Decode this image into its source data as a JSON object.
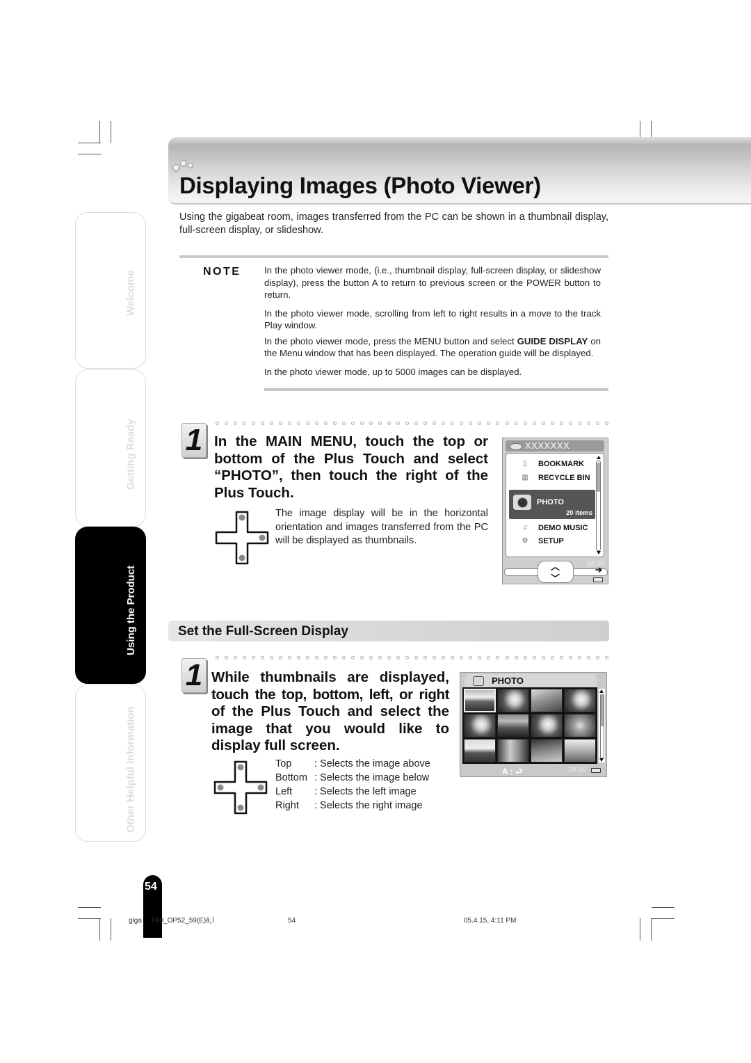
{
  "header": {
    "title": "Displaying Images (Photo Viewer)",
    "intro": "Using the gigabeat room, images transferred from the PC can be shown in a thumbnail display, full-screen display, or slideshow."
  },
  "note": {
    "label": "NOTE",
    "items": [
      {
        "text": "In the photo viewer mode, (i.e., thumbnail display, full-screen display, or slideshow display), press the button A to return to previous screen or the POWER button to return."
      },
      {
        "text": "In the photo viewer mode, scrolling from left to right results in a move to the track Play window."
      },
      {
        "pre": "In the photo viewer mode, press the MENU button and select ",
        "bold": "GUIDE DISPLAY",
        "post": " on the Menu window that has been displayed. The operation guide will be displayed."
      },
      {
        "text": "In the photo viewer mode, up to 5000 images can be displayed."
      }
    ]
  },
  "step1": {
    "number": "1",
    "heading_lines": [
      "In the MAIN MENU, touch the top or",
      "bottom of the Plus Touch and select",
      "“PHOTO”, then touch the right of the",
      "Plus Touch."
    ],
    "body": "The image display will be in the horizontal orientation and images transferred from the PC will be displayed as thumbnails."
  },
  "device_menu": {
    "title": "XXXXXXX",
    "items": [
      {
        "label": "BOOKMARK",
        "icon": "bookmark-icon"
      },
      {
        "label": "RECYCLE BIN",
        "icon": "recycle-bin-icon"
      },
      {
        "label": "PHOTO",
        "icon": "camera-icon",
        "count": "20 items",
        "selected": true
      },
      {
        "label": "DEMO MUSIC",
        "icon": "music-icon"
      },
      {
        "label": "SETUP",
        "icon": "setup-icon"
      }
    ],
    "time": "18:30",
    "arrow": "➔"
  },
  "section": {
    "title": "Set the Full-Screen Display"
  },
  "step2": {
    "number": "1",
    "heading_lines": [
      "While thumbnails are displayed,",
      "touch the top, bottom, left, or right",
      "of the Plus Touch and select the",
      "image that you would like to",
      "display full screen."
    ],
    "directions": [
      {
        "key": "Top",
        "desc": ": Selects the image above"
      },
      {
        "key": "Bottom",
        "desc": ": Selects the image below"
      },
      {
        "key": "Left",
        "desc": ": Selects the left image"
      },
      {
        "key": "Right",
        "desc": ": Selects the right image"
      }
    ]
  },
  "device_photo": {
    "title": "PHOTO",
    "thumbnails": [
      "landscape",
      "cat",
      "railway",
      "cat",
      "cat",
      "city-skyline",
      "cat",
      "dog",
      "road",
      "gate",
      "street",
      "building"
    ],
    "footer_key": "A : ⮐",
    "time": "18:30"
  },
  "sidebar": {
    "tabs": [
      {
        "label": "Welcome",
        "active": false
      },
      {
        "label": "Getting Ready",
        "active": false
      },
      {
        "label": "Using the Product",
        "active": true
      },
      {
        "label": "Other Helpful Information",
        "active": false
      }
    ]
  },
  "page_number": "54",
  "print_footer": {
    "file": "giga     F60_OP52_59(E)â¸î",
    "page": "54",
    "datetime": "05.4.15, 4:11 PM"
  }
}
